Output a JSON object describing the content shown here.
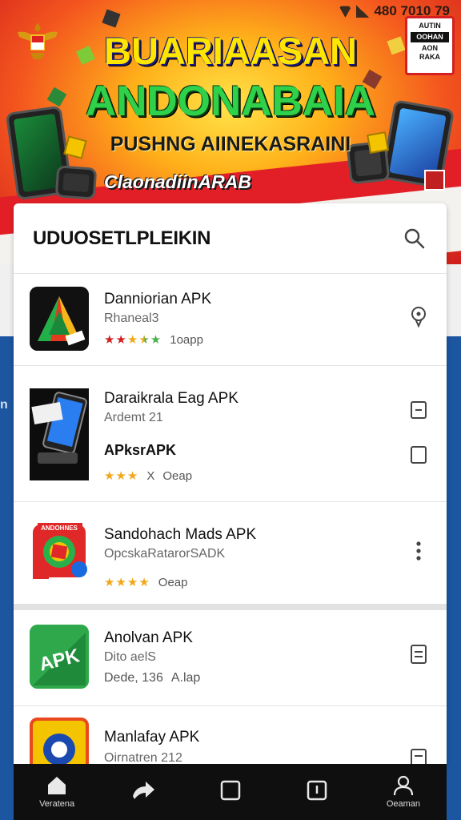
{
  "status_bar": {
    "text": "480 7010 79"
  },
  "banner": {
    "headline1": "BUARIAASAN",
    "headline2": "ANDONABAIA",
    "headline3": "PUSHNG AIINEKASRAINI",
    "tagline": "ClaonadiinARAB",
    "stamp_line1": "AUTIN",
    "stamp_line2": "OOHAN",
    "stamp_line3": "AON",
    "stamp_line4": "RAKA"
  },
  "side_text": "n",
  "card": {
    "title": "UDUOSETLPLEIKIN",
    "search_icon": "search-icon"
  },
  "apps": [
    {
      "name": "Danniorian APK",
      "sub": "Rhaneal3",
      "rating_stars": "★★★★★",
      "size": "1oapp",
      "action_icon": "pin-icon"
    },
    {
      "name": "Daraikrala Eag APK",
      "sub": "Ardemt 21",
      "name2": "APksrAPK",
      "rating_stars": "★★★",
      "extra": "X",
      "size": "Oeap",
      "action_icon": "note-icon",
      "action2_icon": "checkbox-icon"
    },
    {
      "name": "Sandohach Mads APK",
      "sub": "OpcskaRatarorSADK",
      "rating_stars": "★★★★",
      "size": "Oeap",
      "action_icon": "more-vert-icon",
      "icon_text": "ANDOHNES"
    },
    {
      "name": "Anolvan APK",
      "sub": "Dito aelS",
      "meta": "Dede, 136",
      "size": "A.lap",
      "action_icon": "list-icon",
      "icon_text": "APK"
    },
    {
      "name": "Manlafay APK",
      "sub": "Oirnatren 212",
      "action_icon": "list-icon"
    }
  ],
  "bottom_nav": [
    {
      "label": "Veratena",
      "icon": "home-icon"
    },
    {
      "label": "",
      "icon": "share-icon"
    },
    {
      "label": "",
      "icon": "square-icon"
    },
    {
      "label": "",
      "icon": "info-icon"
    },
    {
      "label": "Oeaman",
      "icon": "profile-icon"
    }
  ],
  "colors": {
    "banner_yellow": "#ffe34a",
    "banner_red": "#d01d1d",
    "headline_green": "#2fd14a",
    "star": "#f0a81a",
    "nav_bg": "#0f0f0f",
    "side_blue": "#1c55a0"
  }
}
